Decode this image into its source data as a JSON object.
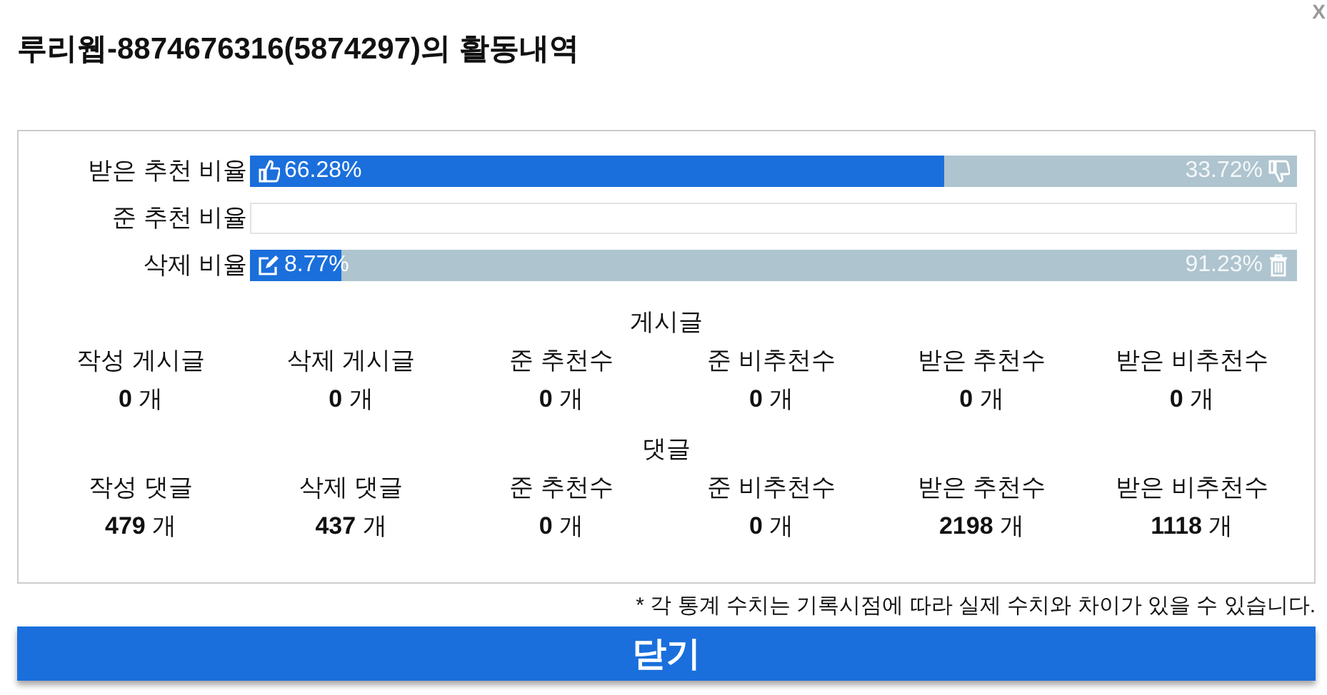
{
  "title": "루리웹-8874676316(5874297)의 활동내역",
  "close_mark": "X",
  "ratios": [
    {
      "label": "받은 추천 비율",
      "kind": "vote",
      "level": 0.6628,
      "left_text": "66.28%",
      "right_text": "33.72%"
    },
    {
      "label": "준 추천 비율",
      "kind": "empty"
    },
    {
      "label": "삭제 비율",
      "kind": "delete",
      "level": 0.0877,
      "left_text": "8.77%",
      "right_text": "91.23%"
    }
  ],
  "sections": [
    {
      "heading": "게시글",
      "stats": [
        {
          "label": "작성 게시글",
          "value": "**0** 개"
        },
        {
          "label": "삭제 게시글",
          "value": "**0** 개"
        },
        {
          "label": "준 추천수",
          "value": "**0** 개"
        },
        {
          "label": "준 비추천수",
          "value": "**0** 개"
        },
        {
          "label": "받은 추천수",
          "value": "**0** 개"
        },
        {
          "label": "받은 비추천수",
          "value": "**0** 개"
        }
      ]
    },
    {
      "heading": "댓글",
      "stats": [
        {
          "label": "작성 댓글",
          "value": "**479** 개"
        },
        {
          "label": "삭제 댓글",
          "value": "**437** 개"
        },
        {
          "label": "준 추천수",
          "value": "**0** 개"
        },
        {
          "label": "준 비추천수",
          "value": "**0** 개"
        },
        {
          "label": "받은 추천수",
          "value": "**2198** 개"
        },
        {
          "label": "받은 비추천수",
          "value": "**1118** 개"
        }
      ]
    }
  ],
  "note": "* 각 통계 수치는 기록시점에 따라 실제 수치와 차이가 있을 수 있습니다.",
  "close_button": "닫기"
}
